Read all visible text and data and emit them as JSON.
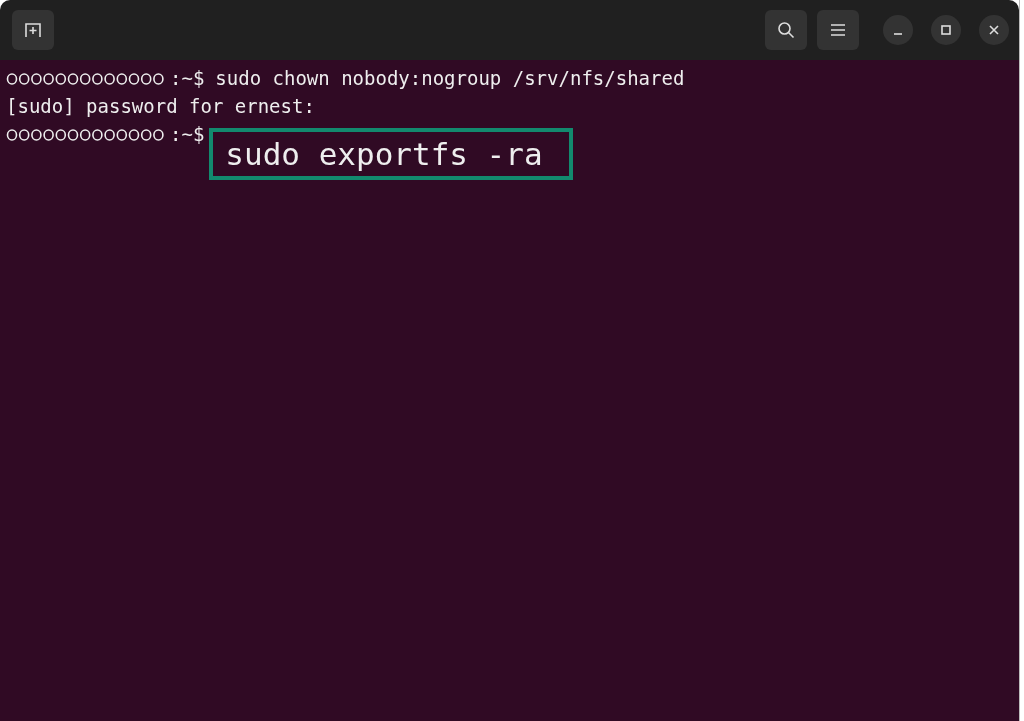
{
  "terminal": {
    "lines": [
      {
        "kind": "command",
        "prompt": ":~$",
        "command": "sudo chown nobody:nogroup /srv/nfs/shared",
        "highlighted": false
      },
      {
        "kind": "output",
        "text": "[sudo] password for ernest:"
      },
      {
        "kind": "command",
        "prompt": ":~$",
        "command": "sudo exportfs -ra",
        "highlighted": true
      }
    ]
  }
}
